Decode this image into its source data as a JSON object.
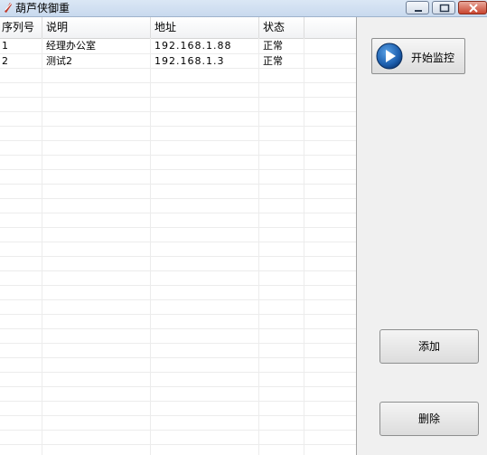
{
  "window": {
    "title": "葫芦侠御重"
  },
  "table": {
    "columns": [
      "序列号",
      "说明",
      "地址",
      "状态"
    ],
    "rows": [
      [
        "1",
        "经理办公室",
        "192.168.1.88",
        "正常"
      ],
      [
        "2",
        "测试2",
        "192.168.1.3",
        "正常"
      ]
    ]
  },
  "actions": {
    "start_label": "开始监控",
    "add_label": "添加",
    "delete_label": "删除"
  }
}
